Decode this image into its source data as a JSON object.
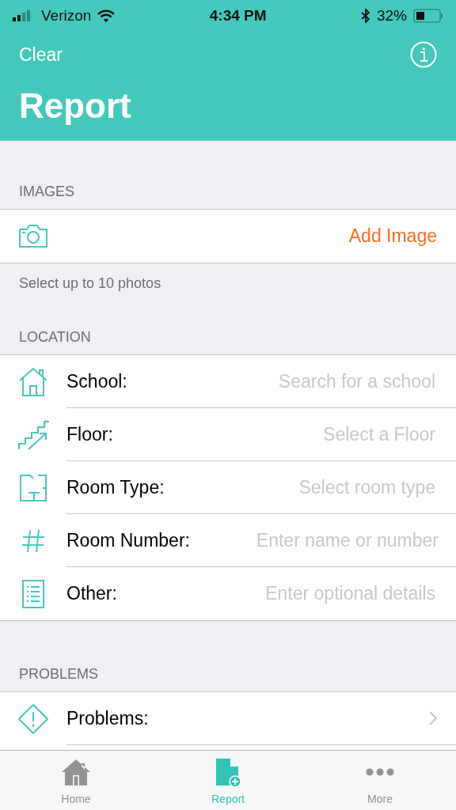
{
  "status_bar": {
    "carrier": "Verizon",
    "time": "4:34 PM",
    "battery": "32%"
  },
  "nav": {
    "left_button": "Clear",
    "title": "Report"
  },
  "images_section": {
    "header": "IMAGES",
    "action": "Add Image",
    "footer": "Select up to 10 photos"
  },
  "location_section": {
    "header": "LOCATION",
    "rows": [
      {
        "label": "School:",
        "placeholder": "Search for a school"
      },
      {
        "label": "Floor:",
        "placeholder": "Select a Floor"
      },
      {
        "label": "Room Type:",
        "placeholder": "Select room type"
      },
      {
        "label": "Room Number:",
        "placeholder": "Enter name or number"
      },
      {
        "label": "Other:",
        "placeholder": "Enter optional details"
      }
    ]
  },
  "problems_section": {
    "header": "PROBLEMS",
    "rows": [
      {
        "label": "Problems:"
      }
    ]
  },
  "tab_bar": [
    {
      "label": "Home",
      "selected": false
    },
    {
      "label": "Report",
      "selected": true
    },
    {
      "label": "More",
      "selected": false
    }
  ]
}
